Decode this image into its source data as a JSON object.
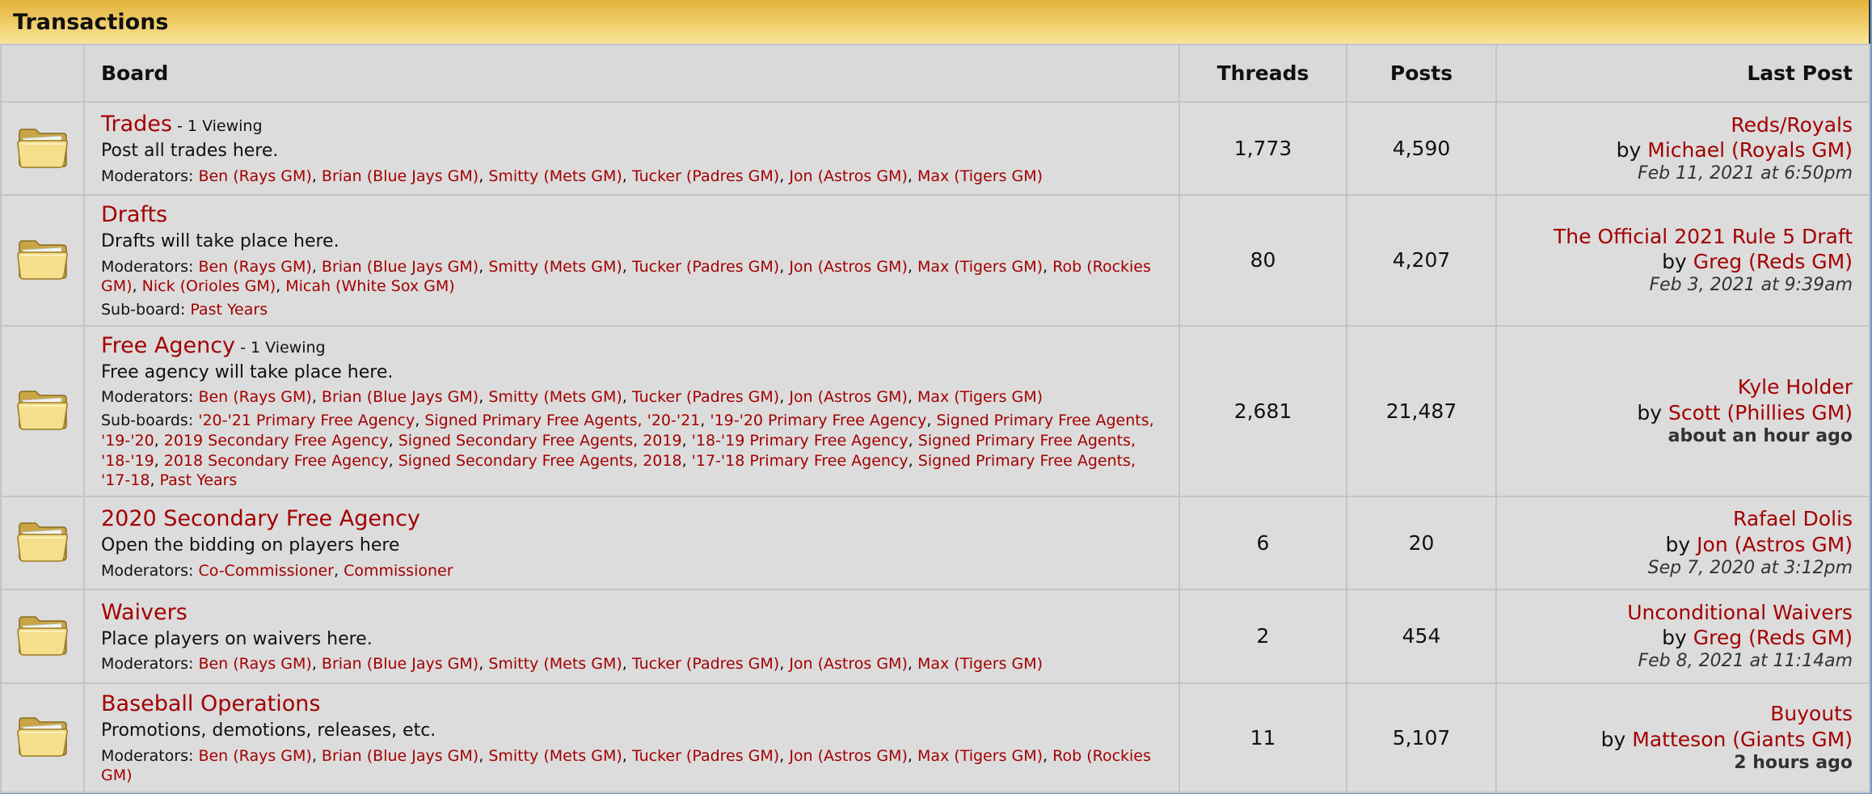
{
  "category": {
    "title": "Transactions"
  },
  "headers": {
    "board": "Board",
    "threads": "Threads",
    "posts": "Posts",
    "last_post": "Last Post"
  },
  "colors": {
    "link": "#a30000",
    "header_gold": "#e3b23c",
    "page_blue": "#6a9bcb"
  },
  "icon": "folder-icon",
  "boards": [
    {
      "name": "Trades",
      "viewing": " - 1 Viewing",
      "description": "Post all trades here.",
      "moderators_label": "Moderators: ",
      "moderators": [
        "Ben (Rays GM)",
        "Brian (Blue Jays GM)",
        "Smitty (Mets GM)",
        "Tucker (Padres GM)",
        "Jon (Astros GM)",
        "Max (Tigers GM)"
      ],
      "subboards_label": "",
      "subboards": [],
      "threads": "1,773",
      "posts": "4,590",
      "last_title": "Reds/Royals",
      "last_by": "by ",
      "last_author": "Michael (Royals GM)",
      "last_time": "Feb 11, 2021 at 6:50pm",
      "time_bold": false
    },
    {
      "name": "Drafts",
      "viewing": "",
      "description": "Drafts will take place here.",
      "moderators_label": "Moderators: ",
      "moderators": [
        "Ben (Rays GM)",
        "Brian (Blue Jays GM)",
        "Smitty (Mets GM)",
        "Tucker (Padres GM)",
        "Jon (Astros GM)",
        "Max (Tigers GM)",
        "Rob (Rockies GM)",
        "Nick (Orioles GM)",
        "Micah (White Sox GM)"
      ],
      "subboards_label": "Sub-board: ",
      "subboards": [
        "Past Years"
      ],
      "threads": "80",
      "posts": "4,207",
      "last_title": "The Official 2021 Rule 5 Draft",
      "last_by": "by ",
      "last_author": "Greg (Reds GM)",
      "last_time": "Feb 3, 2021 at 9:39am",
      "time_bold": false
    },
    {
      "name": "Free Agency",
      "viewing": " - 1 Viewing",
      "description": "Free agency will take place here.",
      "moderators_label": "Moderators: ",
      "moderators": [
        "Ben (Rays GM)",
        "Brian (Blue Jays GM)",
        "Smitty (Mets GM)",
        "Tucker (Padres GM)",
        "Jon (Astros GM)",
        "Max (Tigers GM)"
      ],
      "subboards_label": "Sub-boards: ",
      "subboards": [
        "'20-'21 Primary Free Agency",
        "Signed Primary Free Agents, '20-'21",
        "'19-'20 Primary Free Agency",
        "Signed Primary Free Agents, '19-'20",
        "2019 Secondary Free Agency",
        "Signed Secondary Free Agents, 2019",
        "'18-'19 Primary Free Agency",
        "Signed Primary Free Agents, '18-'19",
        "2018 Secondary Free Agency",
        "Signed Secondary Free Agents, 2018",
        "'17-'18 Primary Free Agency",
        "Signed Primary Free Agents, '17-18",
        "Past Years"
      ],
      "threads": "2,681",
      "posts": "21,487",
      "last_title": "Kyle Holder",
      "last_by": "by ",
      "last_author": "Scott (Phillies GM)",
      "last_time": "about an hour ago",
      "time_bold": true
    },
    {
      "name": "2020 Secondary Free Agency",
      "viewing": "",
      "description": "Open the bidding on players here",
      "moderators_label": "Moderators: ",
      "moderators": [
        "Co-Commissioner",
        "Commissioner"
      ],
      "subboards_label": "",
      "subboards": [],
      "threads": "6",
      "posts": "20",
      "last_title": "Rafael Dolis",
      "last_by": "by ",
      "last_author": "Jon (Astros GM)",
      "last_time": "Sep 7, 2020 at 3:12pm",
      "time_bold": false
    },
    {
      "name": "Waivers",
      "viewing": "",
      "description": "Place players on waivers here.",
      "moderators_label": "Moderators: ",
      "moderators": [
        "Ben (Rays GM)",
        "Brian (Blue Jays GM)",
        "Smitty (Mets GM)",
        "Tucker (Padres GM)",
        "Jon (Astros GM)",
        "Max (Tigers GM)"
      ],
      "subboards_label": "",
      "subboards": [],
      "threads": "2",
      "posts": "454",
      "last_title": "Unconditional Waivers",
      "last_by": "by ",
      "last_author": "Greg (Reds GM)",
      "last_time": "Feb 8, 2021 at 11:14am",
      "time_bold": false
    },
    {
      "name": "Baseball Operations",
      "viewing": "",
      "description": "Promotions, demotions, releases, etc.",
      "moderators_label": "Moderators: ",
      "moderators": [
        "Ben (Rays GM)",
        "Brian (Blue Jays GM)",
        "Smitty (Mets GM)",
        "Tucker (Padres GM)",
        "Jon (Astros GM)",
        "Max (Tigers GM)",
        "Rob (Rockies GM)"
      ],
      "subboards_label": "",
      "subboards": [],
      "threads": "11",
      "posts": "5,107",
      "last_title": "Buyouts",
      "last_by": "by ",
      "last_author": "Matteson (Giants GM)",
      "last_time": "2 hours ago",
      "time_bold": true
    }
  ]
}
